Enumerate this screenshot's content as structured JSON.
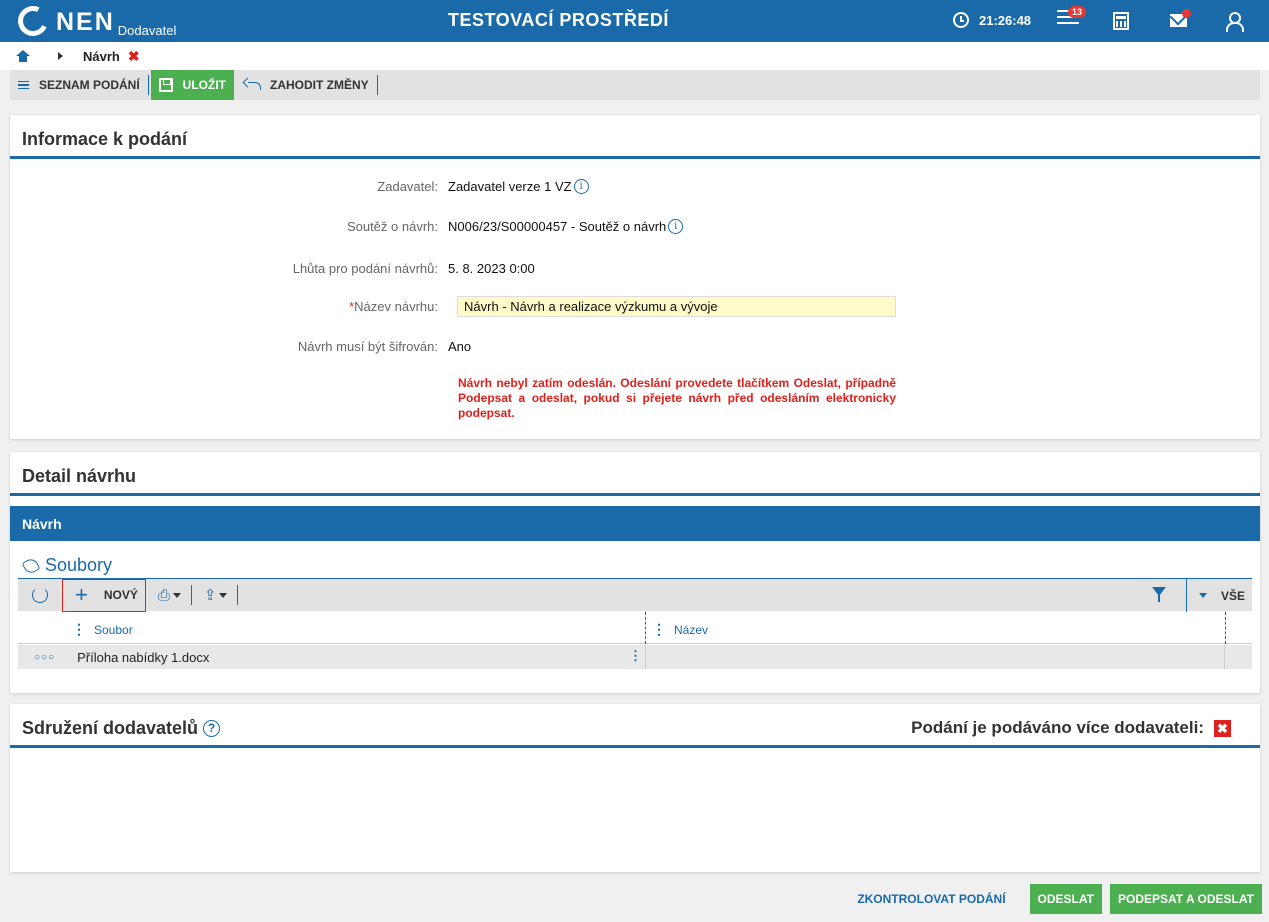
{
  "header": {
    "logo_text": "NEN",
    "logo_sub": "Dodavatel",
    "env_title": "TESTOVACÍ PROSTŘEDÍ",
    "time": "21:26:48",
    "notifications_count": "13"
  },
  "breadcrumb": {
    "current": "Návrh",
    "close": "✖"
  },
  "toolbar": {
    "list_label": "SEZNAM PODÁNÍ",
    "save_label": "ULOŽIT",
    "discard_label": "ZAHODIT ZMĚNY"
  },
  "info": {
    "title": "Informace k podání",
    "fields": {
      "zadavatel_label": "Zadavatel:",
      "zadavatel_value": "Zadavatel verze 1 VZ",
      "soutez_label": "Soutěž o návrh:",
      "soutez_value": "N006/23/S00000457 - Soutěž o návrh",
      "lhuta_label": "Lhůta pro podání návrhů:",
      "lhuta_value": "5. 8. 2023 0:00",
      "nazev_label": "Název návrhu:",
      "nazev_required": "*",
      "nazev_value": "Návrh - Návrh a realizace výzkumu a vývoje",
      "sifrovan_label": "Návrh musí být šifrován:",
      "sifrovan_value": "Ano"
    },
    "warning": "Návrh nebyl zatím odeslán. Odeslání provedete tlačítkem Odeslat, případně Podepsat a odeslat, pokud si přejete návrh před odesláním elektronicky podepsat."
  },
  "detail": {
    "title": "Detail návrhu",
    "section": "Návrh",
    "files_title": "Soubory",
    "new_label": "NOVÝ",
    "filter_all": "VŠE",
    "columns": [
      "Soubor",
      "Název"
    ],
    "rows": [
      {
        "soubor": "Příloha nabídky 1.docx",
        "nazev": ""
      }
    ]
  },
  "sdruzeni": {
    "title": "Sdružení dodavatelů",
    "help": "?",
    "multi_label": "Podání je podáváno více dodavateli:",
    "multi_value": "✖"
  },
  "footer": {
    "check_label": "ZKONTROLOVAT PODÁNÍ",
    "send_label": "ODESLAT",
    "sign_send_label": "PODEPSAT A ODESLAT"
  }
}
